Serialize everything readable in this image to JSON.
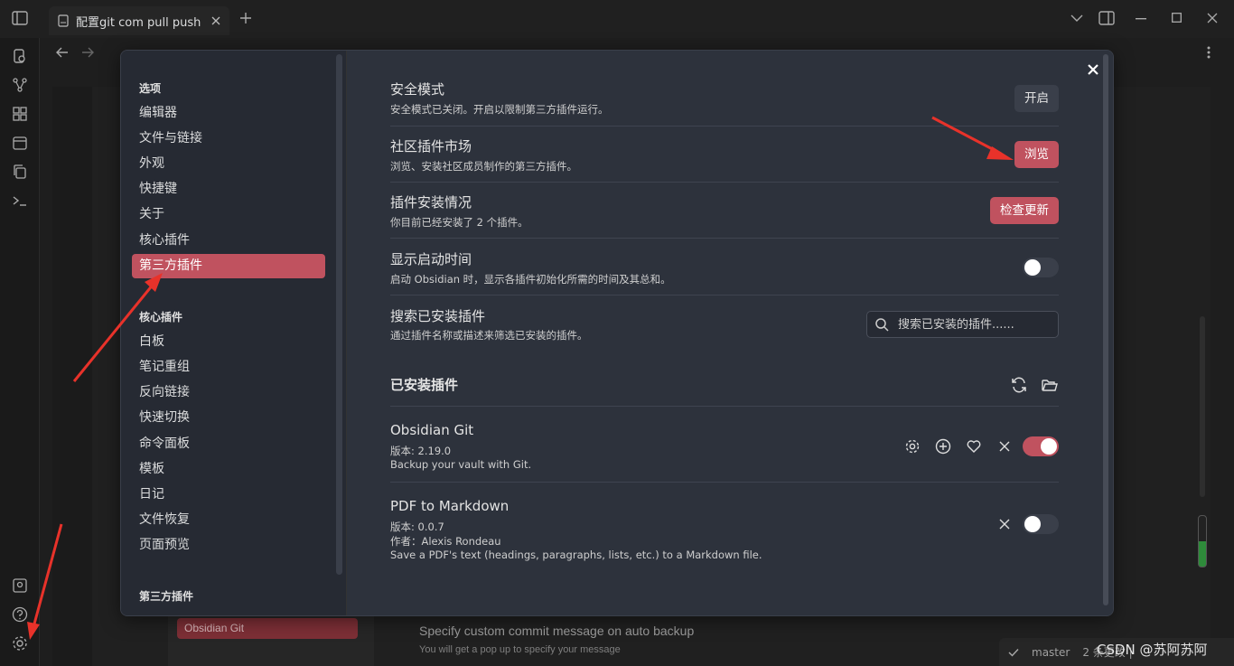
{
  "titlebar": {
    "tab_title": "配置git com pull push"
  },
  "background": {
    "left_item": "Obsidian Git",
    "setting_title": "Specify custom commit message on auto backup",
    "setting_desc": "You will get a pop up to specify your message",
    "status_branch": "master",
    "status_changes": "2 条更改 |"
  },
  "watermark": "CSDN @苏阿苏阿",
  "sidebar": {
    "section_options": "选项",
    "options": [
      "编辑器",
      "文件与链接",
      "外观",
      "快捷键",
      "关于",
      "核心插件",
      "第三方插件"
    ],
    "section_core": "核心插件",
    "core": [
      "白板",
      "笔记重组",
      "反向链接",
      "快速切换",
      "命令面板",
      "模板",
      "日记",
      "文件恢复",
      "页面预览"
    ],
    "section_third": "第三方插件",
    "active": "第三方插件"
  },
  "settings": [
    {
      "title": "安全模式",
      "desc": "安全模式已关闭。开启以限制第三方插件运行。",
      "button": "开启"
    },
    {
      "title": "社区插件市场",
      "desc": "浏览、安装社区成员制作的第三方插件。",
      "button": "浏览"
    },
    {
      "title": "插件安装情况",
      "desc": "你目前已经安装了 2 个插件。",
      "button": "检查更新"
    },
    {
      "title": "显示启动时间",
      "desc": "启动 Obsidian 时，显示各插件初始化所需的时间及其总和。",
      "toggle": false
    },
    {
      "title": "搜索已安装插件",
      "desc": "通过插件名称或描述来筛选已安装的插件。",
      "placeholder": "搜索已安装的插件......"
    }
  ],
  "installed": {
    "heading": "已安装插件",
    "plugins": [
      {
        "name": "Obsidian Git",
        "version": "版本: 2.19.0",
        "desc": "Backup your vault with Git.",
        "enabled": true
      },
      {
        "name": "PDF to Markdown",
        "version": "版本: 0.0.7",
        "author": "作者：Alexis Rondeau",
        "desc": "Save a PDF's text (headings, paragraphs, lists, etc.) to a Markdown file.",
        "enabled": false
      }
    ]
  },
  "colors": {
    "accent": "#c0525f",
    "modal_bg": "#2d323c",
    "sidebar_bg": "#262a33",
    "annotation_arrow": "#e8322a"
  }
}
